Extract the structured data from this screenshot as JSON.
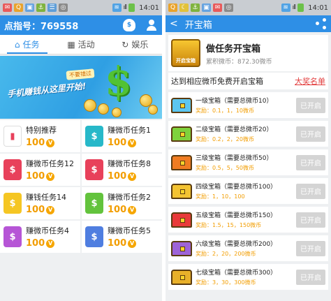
{
  "left": {
    "status_bar": {
      "signal": "ıll",
      "time": "14:01"
    },
    "header": {
      "points_label": "点指号：769558",
      "bag_icon_text": "$"
    },
    "tabs": [
      {
        "label": "任务",
        "icon": "home-icon",
        "active": true
      },
      {
        "label": "活动",
        "icon": "grid-icon",
        "active": false
      },
      {
        "label": "娱乐",
        "icon": "refresh-icon",
        "active": false
      }
    ],
    "banner": {
      "badge": "不要错过",
      "slogan": "手机赚钱从这里开始!",
      "dollar": "$"
    },
    "tasks": [
      {
        "name": "特别推荐",
        "reward": "100",
        "color": "#ffffff"
      },
      {
        "name": "赚微币任务1",
        "reward": "100",
        "color": "#27b8c9"
      },
      {
        "name": "赚微币任务12",
        "reward": "100",
        "color": "#e8415b"
      },
      {
        "name": "赚微币任务8",
        "reward": "100",
        "color": "#e8415b"
      },
      {
        "name": "赚钱任务14",
        "reward": "100",
        "color": "#f5c623"
      },
      {
        "name": "赚微币任务2",
        "reward": "100",
        "color": "#63c33d"
      },
      {
        "name": "赚微币任务4",
        "reward": "100",
        "color": "#b655d6"
      },
      {
        "name": "赚微币任务5",
        "reward": "100",
        "color": "#4f7ee0"
      }
    ],
    "coin_symbol": "V"
  },
  "right": {
    "status_bar": {
      "signal": "ıll",
      "time": "14:01"
    },
    "header": {
      "title": "开宝箱",
      "back": "<"
    },
    "intro": {
      "title": "做任务开宝箱",
      "subtitle": "累积微币：872.30微币",
      "chest_label": "开启宝箱"
    },
    "notice": {
      "text": "达到相应微币免费开启宝箱",
      "link": "大奖名单"
    },
    "chests": [
      {
        "name": "一级宝箱（需要总微币10）",
        "reward": "奖励：0.1，1，10微币",
        "button": "已开启",
        "color": "#5cc6f0"
      },
      {
        "name": "二级宝箱（需要总微币20）",
        "reward": "奖励：0.2，2，20微币",
        "button": "已开启",
        "color": "#7fd23c"
      },
      {
        "name": "三级宝箱（需要总微币50）",
        "reward": "奖励：0.5，5，50微币",
        "button": "已开启",
        "color": "#f07c22"
      },
      {
        "name": "四级宝箱（需要总微币100）",
        "reward": "奖励：1，10，100",
        "button": "已开启",
        "color": "#f3c332"
      },
      {
        "name": "五级宝箱（需要总微币150）",
        "reward": "奖励：1.5，15，150微币",
        "button": "已开启",
        "color": "#e93a3a"
      },
      {
        "name": "六级宝箱（需要总微币200）",
        "reward": "奖励：2，20，200微币",
        "button": "已开启",
        "color": "#9d63d8"
      },
      {
        "name": "七级宝箱（需要总微币300）",
        "reward": "奖励：3，30，300微币",
        "button": "已开启",
        "color": "#e8b02a"
      }
    ]
  }
}
